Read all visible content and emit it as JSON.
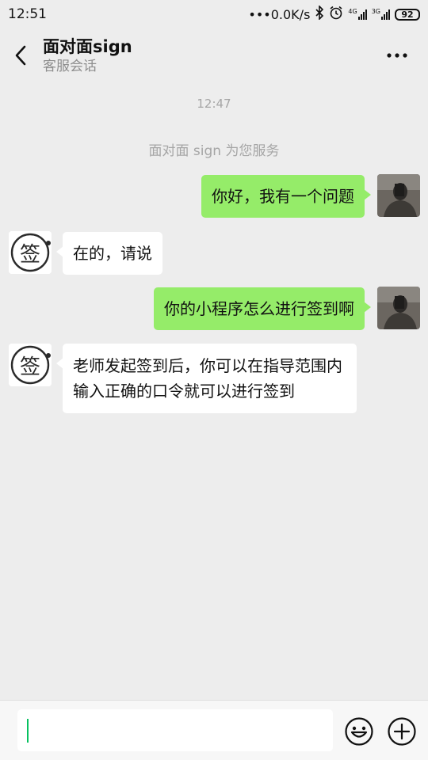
{
  "status_bar": {
    "time": "12:51",
    "net_speed": "•••0.0K/s",
    "sim1_label": "4G",
    "sim2_label": "3G",
    "battery": "92"
  },
  "header": {
    "title": "面对面sign",
    "subtitle": "客服会话"
  },
  "chat": {
    "timestamp": "12:47",
    "service_note": "面对面 sign 为您服务",
    "bot_avatar_char": "签",
    "messages": [
      {
        "from": "me",
        "text": "你好，我有一个问题"
      },
      {
        "from": "them",
        "text": "在的，请说"
      },
      {
        "from": "me",
        "text": "你的小程序怎么进行签到啊"
      },
      {
        "from": "them",
        "text": "老师发起签到后，你可以在指导范围内输入正确的口令就可以进行签到"
      }
    ]
  },
  "input": {
    "value": ""
  },
  "colors": {
    "my_bubble": "#95ec69",
    "their_bubble": "#ffffff",
    "background": "#ededed",
    "accent": "#07c160"
  }
}
